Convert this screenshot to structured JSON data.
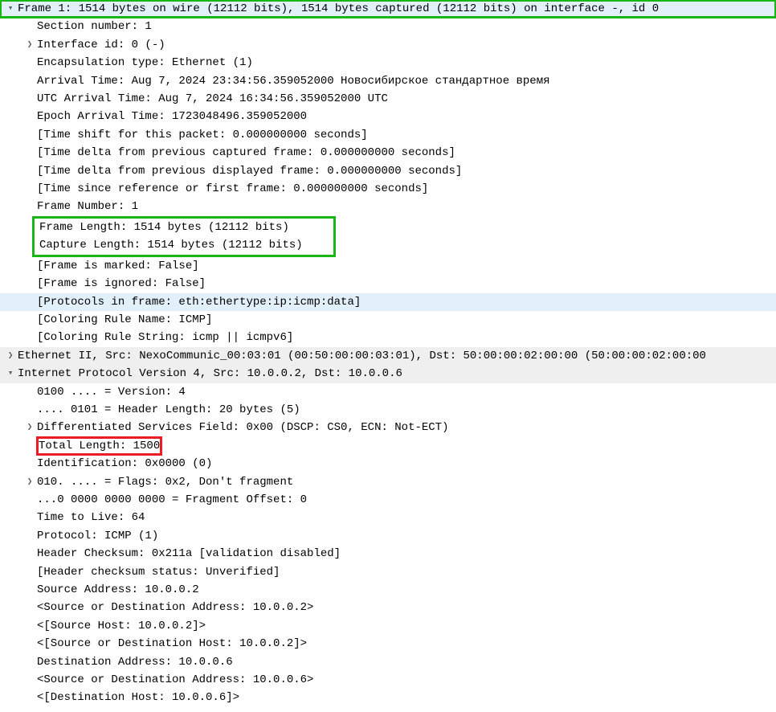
{
  "frame": {
    "summary": "Frame 1: 1514 bytes on wire (12112 bits), 1514 bytes captured (12112 bits) on interface -, id 0",
    "section_number": "Section number: 1",
    "interface_id": "Interface id: 0 (-)",
    "encapsulation": "Encapsulation type: Ethernet (1)",
    "arrival_time": "Arrival Time: Aug  7, 2024 23:34:56.359052000 Новосибирское стандартное время",
    "utc_arrival_time": "UTC Arrival Time: Aug  7, 2024 16:34:56.359052000 UTC",
    "epoch_arrival_time": "Epoch Arrival Time: 1723048496.359052000",
    "time_shift": "[Time shift for this packet: 0.000000000 seconds]",
    "time_delta_captured": "[Time delta from previous captured frame: 0.000000000 seconds]",
    "time_delta_displayed": "[Time delta from previous displayed frame: 0.000000000 seconds]",
    "time_since_ref": "[Time since reference or first frame: 0.000000000 seconds]",
    "frame_number": "Frame Number: 1",
    "frame_length": "Frame Length: 1514 bytes (12112 bits)",
    "capture_length": "Capture Length: 1514 bytes (12112 bits)",
    "frame_marked": "[Frame is marked: False]",
    "frame_ignored": "[Frame is ignored: False]",
    "protocols": "[Protocols in frame: eth:ethertype:ip:icmp:data]",
    "coloring_name": "[Coloring Rule Name: ICMP]",
    "coloring_string": "[Coloring Rule String: icmp || icmpv6]"
  },
  "ethernet": {
    "summary": "Ethernet II, Src: NexoCommunic_00:03:01 (00:50:00:00:03:01), Dst: 50:00:00:02:00:00 (50:00:00:02:00:00"
  },
  "ip": {
    "summary": "Internet Protocol Version 4, Src: 10.0.0.2, Dst: 10.0.0.6",
    "version": "0100 .... = Version: 4",
    "header_length": ".... 0101 = Header Length: 20 bytes (5)",
    "dsfield": "Differentiated Services Field: 0x00 (DSCP: CS0, ECN: Not-ECT)",
    "total_length": "Total Length: 1500",
    "identification": "Identification: 0x0000 (0)",
    "flags": "010. .... = Flags: 0x2, Don't fragment",
    "fragment_offset": "...0 0000 0000 0000 = Fragment Offset: 0",
    "ttl": "Time to Live: 64",
    "protocol": "Protocol: ICMP (1)",
    "checksum": "Header Checksum: 0x211a [validation disabled]",
    "checksum_status": "[Header checksum status: Unverified]",
    "src_addr": "Source Address: 10.0.0.2",
    "src_or_dst_addr1": "<Source or Destination Address: 10.0.0.2>",
    "src_host": "<[Source Host: 10.0.0.2]>",
    "src_or_dst_host1": "<[Source or Destination Host: 10.0.0.2]>",
    "dst_addr": "Destination Address: 10.0.0.6",
    "src_or_dst_addr2": "<Source or Destination Address: 10.0.0.6>",
    "dst_host": "<[Destination Host: 10.0.0.6]>"
  },
  "highlight": {
    "frame_summary_color": "#18b715",
    "frame_length_box_color": "#18b715",
    "total_length_box_color": "#ed1c24"
  }
}
